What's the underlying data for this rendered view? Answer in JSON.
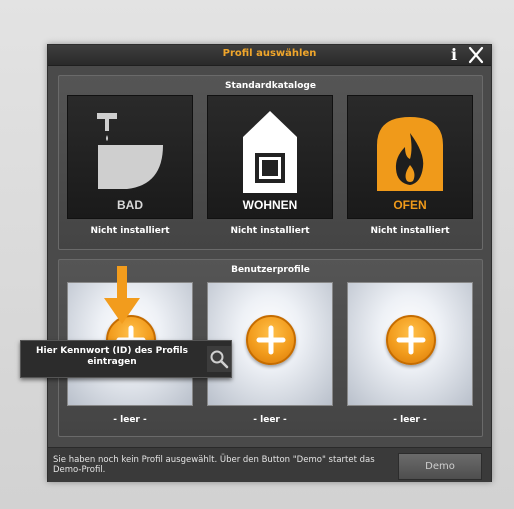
{
  "dialog": {
    "title": "Profil auswählen",
    "colors": {
      "accent": "#f0a62b",
      "background": "#4a4a4a"
    }
  },
  "standard": {
    "heading": "Standardkataloge",
    "tiles": [
      {
        "word": "BAD",
        "caption": "Nicht installiert",
        "icon": "bath-icon"
      },
      {
        "word": "WOHNEN",
        "caption": "Nicht installiert",
        "icon": "house-icon"
      },
      {
        "word": "OFEN",
        "caption": "Nicht installiert",
        "icon": "fireplace-icon"
      }
    ]
  },
  "user": {
    "heading": "Benutzerprofile",
    "tiles": [
      {
        "caption": "- leer -",
        "icon": "plus-icon"
      },
      {
        "caption": "- leer -",
        "icon": "plus-icon"
      },
      {
        "caption": "- leer -",
        "icon": "plus-icon"
      }
    ]
  },
  "tooltip": {
    "text": "Hier Kennwort (ID) des Profils eintragen",
    "icon": "search-icon"
  },
  "status": {
    "text": "Sie haben noch kein Profil ausgewählt. Über den Button \"Demo\" startet das Demo-Profil.",
    "demo_label": "Demo"
  }
}
